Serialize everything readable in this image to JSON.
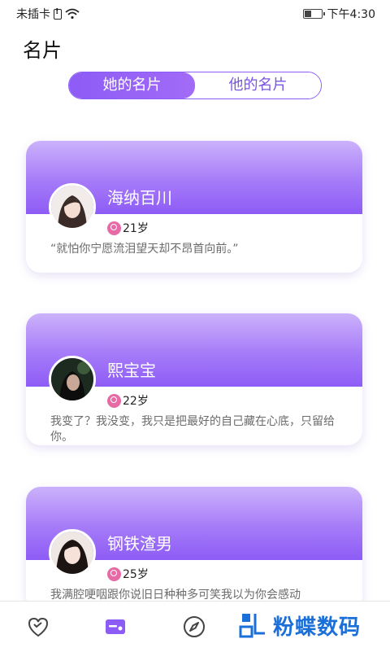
{
  "status_bar": {
    "carrier": "未插卡",
    "time": "下午4:30"
  },
  "page": {
    "title": "名片"
  },
  "tabs": [
    {
      "label": "她的名片",
      "active": true
    },
    {
      "label": "他的名片",
      "active": false
    }
  ],
  "cards": [
    {
      "name": "海纳百川",
      "age": "21岁",
      "bio": "“就怕你宁愿流泪望天却不昂首向前。”"
    },
    {
      "name": "熙宝宝",
      "age": "22岁",
      "bio": "我变了？我没变，我只是把最好的自己藏在心底，只留给你。"
    },
    {
      "name": "钢铁渣男",
      "age": "25岁",
      "bio": "我满腔哽咽跟你说旧日种种多可笑我以为你会感动"
    }
  ],
  "bottom_nav": {
    "items": [
      {
        "icon": "heart-chat-icon"
      },
      {
        "icon": "card-icon"
      },
      {
        "icon": "compass-icon"
      }
    ]
  },
  "watermark": {
    "text": "粉蝶数码"
  },
  "colors": {
    "accent": "#8d5cf6",
    "female": "#e56aa6",
    "watermark": "#1a6fd9"
  }
}
